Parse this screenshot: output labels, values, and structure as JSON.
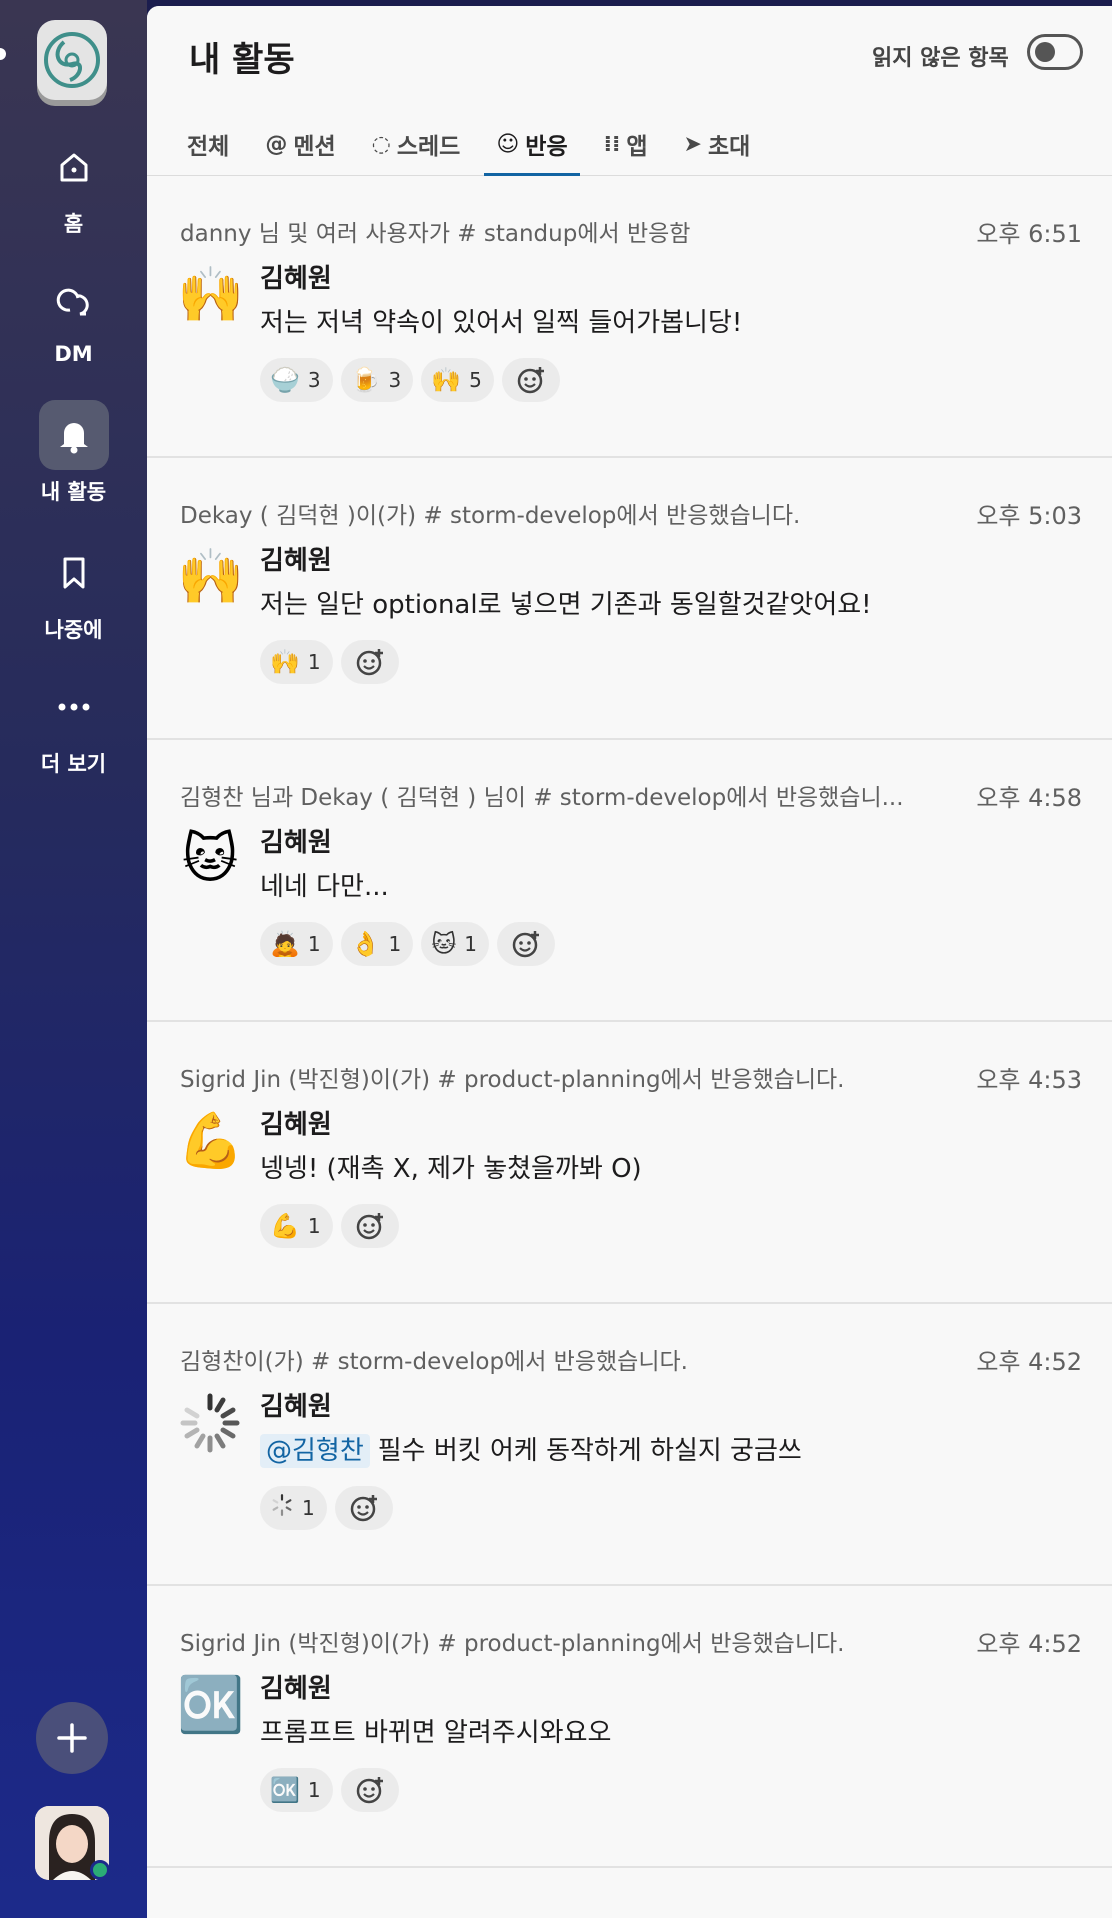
{
  "sidebar": {
    "nav": [
      {
        "label": "홈",
        "icon": "home-icon"
      },
      {
        "label": "DM",
        "icon": "dm-icon"
      },
      {
        "label": "내 활동",
        "icon": "bell-icon"
      },
      {
        "label": "나중에",
        "icon": "bookmark-icon"
      },
      {
        "label": "더 보기",
        "icon": "more-icon"
      }
    ]
  },
  "header": {
    "title": "내 활동",
    "unread_label": "읽지 않은 항목",
    "tabs": [
      {
        "label": "전체",
        "icon": ""
      },
      {
        "label": "멘션",
        "icon": "@"
      },
      {
        "label": "스레드",
        "icon": "◌"
      },
      {
        "label": "반응",
        "icon": "☺"
      },
      {
        "label": "앱",
        "icon": "⁞⁞"
      },
      {
        "label": "초대",
        "icon": "➤"
      }
    ]
  },
  "items": [
    {
      "meta": "danny 님 및 여러 사용자가 # standup에서 반응함",
      "time": "오후 6:51",
      "emoji": "🙌",
      "author": "김혜원",
      "message": "저는 저녁 약속이 있어서 일찍 들어가봅니당!",
      "reactions": [
        {
          "emoji": "🍚",
          "count": "3"
        },
        {
          "emoji": "🍺",
          "count": "3"
        },
        {
          "emoji": "🙌",
          "count": "5"
        }
      ]
    },
    {
      "meta": "Dekay ( 김덕현 )이(가) # storm-develop에서 반응했습니다.",
      "time": "오후 5:03",
      "emoji": "🙌",
      "author": "김혜원",
      "message": "저는 일단 optional로 넣으면 기존과 동일할것같앗어요!",
      "reactions": [
        {
          "emoji": "🙌",
          "count": "1"
        }
      ]
    },
    {
      "meta": "김형찬 님과 Dekay ( 김덕현 ) 님이 # storm-develop에서 반응했습니...",
      "time": "오후 4:58",
      "emoji": "🐱",
      "author": "김혜원",
      "message": "네네 다만...",
      "reactions": [
        {
          "emoji": "🙇",
          "count": "1"
        },
        {
          "emoji": "👌",
          "count": "1"
        },
        {
          "emoji": "🐱",
          "count": "1"
        }
      ]
    },
    {
      "meta": "Sigrid Jin (박진형)이(가) # product-planning에서 반응했습니다.",
      "time": "오후 4:53",
      "emoji": "💪",
      "author": "김혜원",
      "message": "넹넹! (재촉 X, 제가 놓쳤을까봐 O)",
      "reactions": [
        {
          "emoji": "💪",
          "count": "1"
        }
      ]
    },
    {
      "meta": "김형찬이(가) # storm-develop에서 반응했습니다.",
      "time": "오후 4:52",
      "emoji": "✳",
      "author": "김혜원",
      "mention": "@김형찬",
      "message": "필수 버킷 어케 동작하게 하실지 궁금쓰",
      "reactions": [
        {
          "emoji": "✳",
          "count": "1"
        }
      ]
    },
    {
      "meta": "Sigrid Jin (박진형)이(가) # product-planning에서 반응했습니다.",
      "time": "오후 4:52",
      "emoji": "🆗",
      "author": "김혜원",
      "message": "프롬프트 바뀌면 알려주시와요오",
      "reactions": [
        {
          "emoji": "🆗",
          "count": "1"
        }
      ]
    }
  ]
}
